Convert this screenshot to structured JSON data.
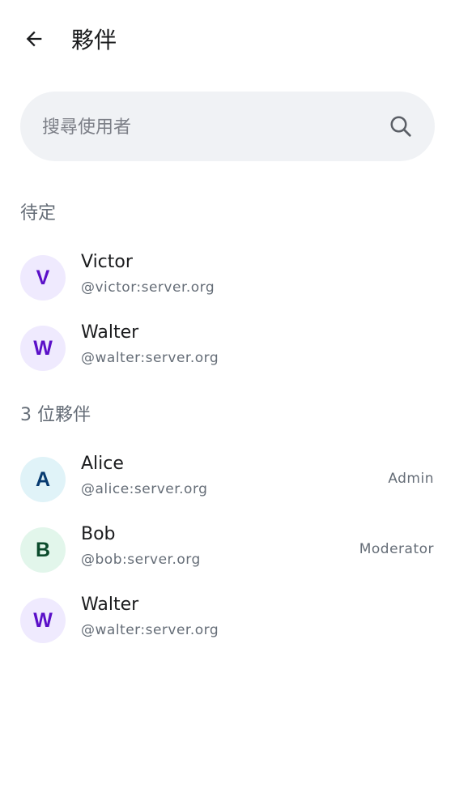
{
  "header": {
    "title": "夥伴",
    "back_icon": "arrow-left-icon"
  },
  "search": {
    "placeholder": "搜尋使用者",
    "icon": "search-icon"
  },
  "pending": {
    "header": "待定",
    "members": [
      {
        "initial": "V",
        "name": "Victor",
        "handle": "@victor:server.org",
        "avatar_bg": "#efeafe",
        "avatar_fg": "#5a0fc8"
      },
      {
        "initial": "W",
        "name": "Walter",
        "handle": "@walter:server.org",
        "avatar_bg": "#efeafe",
        "avatar_fg": "#5a0fc8"
      }
    ]
  },
  "joined": {
    "header": "3 位夥伴",
    "members": [
      {
        "initial": "A",
        "name": "Alice",
        "handle": "@alice:server.org",
        "role": "Admin",
        "avatar_bg": "#e0f3f8",
        "avatar_fg": "#063a70"
      },
      {
        "initial": "B",
        "name": "Bob",
        "handle": "@bob:server.org",
        "role": "Moderator",
        "avatar_bg": "#e2f6eb",
        "avatar_fg": "#0b4b2c"
      },
      {
        "initial": "W",
        "name": "Walter",
        "handle": "@walter:server.org",
        "role": "",
        "avatar_bg": "#efeafe",
        "avatar_fg": "#5a0fc8"
      }
    ]
  }
}
